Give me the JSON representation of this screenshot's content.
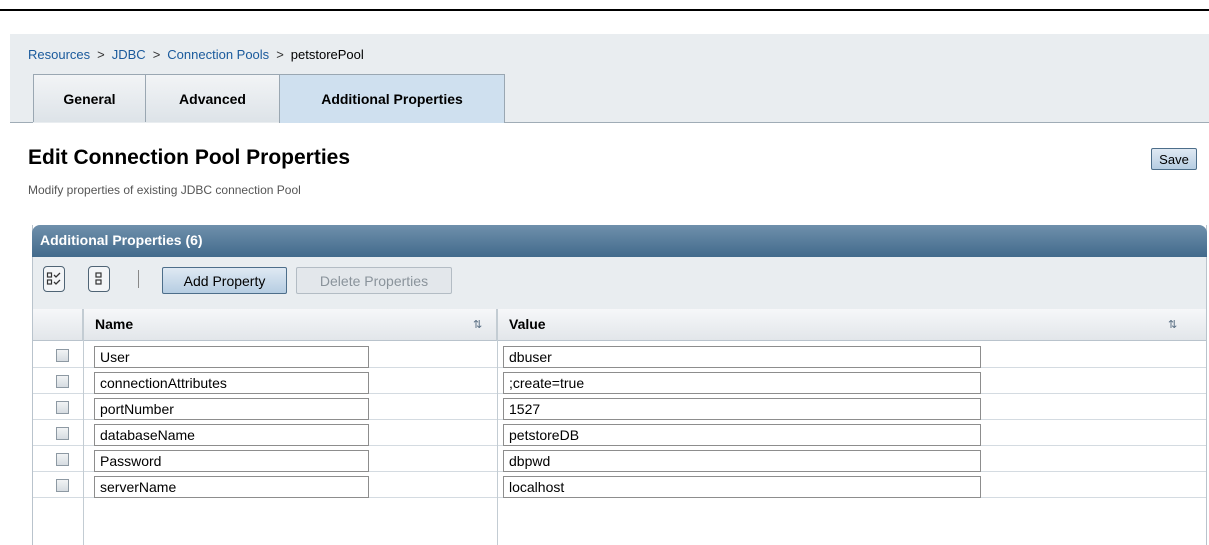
{
  "breadcrumb": [
    {
      "label": "Resources"
    },
    {
      "label": "JDBC"
    },
    {
      "label": "Connection Pools"
    },
    {
      "label": "petstorePool"
    }
  ],
  "breadcrumb_separator": ">",
  "tabs": [
    {
      "label": "General",
      "active": false
    },
    {
      "label": "Advanced",
      "active": false
    },
    {
      "label": "Additional Properties",
      "active": true
    }
  ],
  "page": {
    "title": "Edit Connection Pool Properties",
    "description": "Modify properties of existing JDBC connection Pool",
    "save_label": "Save"
  },
  "table": {
    "title": "Additional Properties (6)",
    "toolbar": {
      "select_all_icon": "select-all-icon",
      "deselect_all_icon": "deselect-all-icon",
      "add_label": "Add Property",
      "delete_label": "Delete Properties",
      "delete_enabled": false
    },
    "columns": [
      {
        "label": "Name",
        "sortable": true
      },
      {
        "label": "Value",
        "sortable": true
      }
    ],
    "rows": [
      {
        "name": "User",
        "value": "dbuser",
        "checked": false
      },
      {
        "name": "connectionAttributes",
        "value": ";create=true",
        "checked": false
      },
      {
        "name": "portNumber",
        "value": "1527",
        "checked": false
      },
      {
        "name": "databaseName",
        "value": "petstoreDB",
        "checked": false
      },
      {
        "name": "Password",
        "value": "dbpwd",
        "checked": false
      },
      {
        "name": "serverName",
        "value": "localhost",
        "checked": false
      }
    ]
  },
  "colors": {
    "link": "#1a5a9c",
    "panel_header": "#426a8c",
    "header_band": "#e9edf0"
  }
}
